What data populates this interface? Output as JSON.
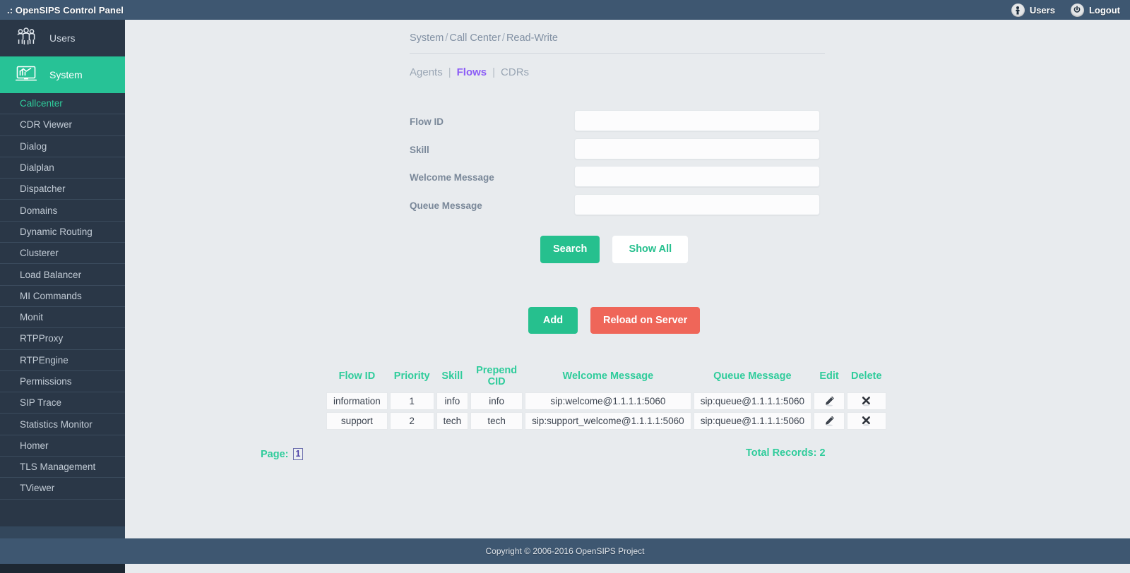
{
  "topbar": {
    "brand": ".: OpenSIPS Control Panel",
    "users_label": "Users",
    "users_icon": "person-circle-icon",
    "logout_label": "Logout",
    "logout_icon": "power-circle-icon"
  },
  "sidebar": {
    "main_items": [
      {
        "label": "Users",
        "icon": "users-group-icon",
        "active": false
      },
      {
        "label": "System",
        "icon": "system-monitor-icon",
        "active": true
      }
    ],
    "sub_items": [
      {
        "label": "Callcenter",
        "active": true
      },
      {
        "label": "CDR Viewer",
        "active": false
      },
      {
        "label": "Dialog",
        "active": false
      },
      {
        "label": "Dialplan",
        "active": false
      },
      {
        "label": "Dispatcher",
        "active": false
      },
      {
        "label": "Domains",
        "active": false
      },
      {
        "label": "Dynamic Routing",
        "active": false
      },
      {
        "label": "Clusterer",
        "active": false
      },
      {
        "label": "Load Balancer",
        "active": false
      },
      {
        "label": "MI Commands",
        "active": false
      },
      {
        "label": "Monit",
        "active": false
      },
      {
        "label": "RTPProxy",
        "active": false
      },
      {
        "label": "RTPEngine",
        "active": false
      },
      {
        "label": "Permissions",
        "active": false
      },
      {
        "label": "SIP Trace",
        "active": false
      },
      {
        "label": "Statistics Monitor",
        "active": false
      },
      {
        "label": "Homer",
        "active": false
      },
      {
        "label": "TLS Management",
        "active": false
      },
      {
        "label": "TViewer",
        "active": false
      }
    ]
  },
  "breadcrumb": {
    "part1": "System",
    "part2": "Call Center",
    "part3": "Read-Write",
    "separator": "/"
  },
  "tabs": [
    {
      "label": "Agents",
      "active": false
    },
    {
      "label": "Flows",
      "active": true
    },
    {
      "label": "CDRs",
      "active": false
    }
  ],
  "tab_separator": "|",
  "search_form": {
    "fields": [
      {
        "label": "Flow ID",
        "value": "",
        "placeholder": ""
      },
      {
        "label": "Skill",
        "value": "",
        "placeholder": ""
      },
      {
        "label": "Welcome Message",
        "value": "",
        "placeholder": ""
      },
      {
        "label": "Queue Message",
        "value": "",
        "placeholder": ""
      }
    ],
    "search_label": "Search",
    "show_all_label": "Show All"
  },
  "actions": {
    "add_label": "Add",
    "reload_label": "Reload on Server"
  },
  "table": {
    "columns": [
      "Flow ID",
      "Priority",
      "Skill",
      "Prepend CID",
      "Welcome Message",
      "Queue Message",
      "Edit",
      "Delete"
    ],
    "rows": [
      {
        "flow_id": "information",
        "priority": "1",
        "skill": "info",
        "prepend_cid": "info",
        "welcome_message": "sip:welcome@1.1.1.1:5060",
        "queue_message": "sip:queue@1.1.1.1:5060",
        "edit_icon": "pencil-icon",
        "delete_icon": "x-cross-icon"
      },
      {
        "flow_id": "support",
        "priority": "2",
        "skill": "tech",
        "prepend_cid": "tech",
        "welcome_message": "sip:support_welcome@1.1.1.1:5060",
        "queue_message": "sip:queue@1.1.1.1:5060",
        "edit_icon": "pencil-icon",
        "delete_icon": "x-cross-icon"
      }
    ]
  },
  "pagination": {
    "page_label": "Page:",
    "current_page": "1",
    "total_records_label": "Total Records: 2"
  },
  "footer": {
    "copyright": "Copyright © 2006-2016 OpenSIPS Project"
  },
  "colors": {
    "accent_teal": "#2fcc9b",
    "header_navy": "#3e5771",
    "sidebar_navy": "#2a3747",
    "danger_red": "#ef6659",
    "active_tab_purple": "#8b5cf6",
    "page_bg": "#e8ebee"
  }
}
